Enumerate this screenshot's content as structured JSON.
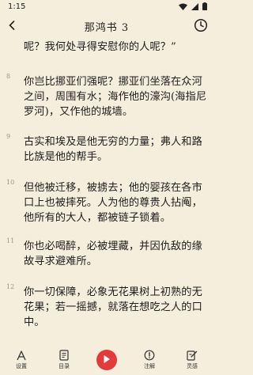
{
  "status_bar": {
    "time": "1:15"
  },
  "header": {
    "title": "那鸿书 3"
  },
  "verses": [
    {
      "number": "",
      "lines": [
        "呢？我何处寻得安慰你的人呢？”"
      ]
    },
    {
      "number": "8",
      "lines": [
        "你岂比挪亚们强呢？挪亚们坐落在众河",
        "之间，周围有水；海作他的濠沟(海指尼",
        "罗河)，又作他的城墙。"
      ]
    },
    {
      "number": "9",
      "lines": [
        "古实和埃及是他无穷的力量；弗人和路",
        "比族是他的帮手。"
      ]
    },
    {
      "number": "10",
      "lines": [
        "但他被迁移，被掳去；他的婴孩在各市",
        "口上也被摔死。人为他的尊贵人拈阄，",
        "他所有的大人，都被链子锁着。"
      ]
    },
    {
      "number": "11",
      "lines": [
        "你也必喝醉，必被埋藏，并因仇敌的缘",
        "故寻求避难所。"
      ]
    },
    {
      "number": "12",
      "lines": [
        "你一切保障，必象无花果树上初熟的无",
        "花果；若一摇撼，就落在想吃之人的口",
        "中。"
      ]
    }
  ],
  "bottom_nav": {
    "settings": "设置",
    "catalog": "目录",
    "notes": "注解",
    "devotional": "灵感"
  }
}
